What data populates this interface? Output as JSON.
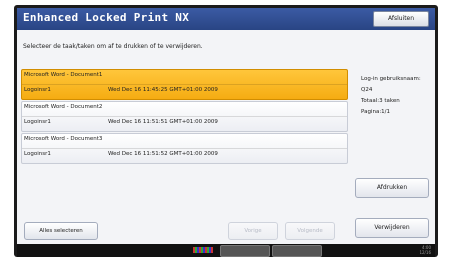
{
  "app": {
    "title": "Enhanced Locked Print NX",
    "close_label": "Afsluiten"
  },
  "instruction": "Selecteer de taak/taken om af te drukken of te verwijderen.",
  "jobs": [
    {
      "document": "Microsoft Word - Document1",
      "user": "Logoinsr1",
      "datetime": "Wed Dec 16 11:45:25 GMT+01:00 2009",
      "selected": true
    },
    {
      "document": "Microsoft Word - Document2",
      "user": "Logoinsr1",
      "datetime": "Wed Dec 16 11:51:51 GMT+01:00 2009",
      "selected": false
    },
    {
      "document": "Microsoft Word - Document3",
      "user": "Logoinsr1",
      "datetime": "Wed Dec 16 11:51:52 GMT+01:00 2009",
      "selected": false
    }
  ],
  "info": {
    "line1": "Log-in gebruiksnaam:",
    "line2": "Q24",
    "line3": "Totaal:3 taken",
    "line4": "Pagina:1/1"
  },
  "buttons": {
    "print": "Afdrukken",
    "delete": "Verwijderen",
    "select_all": "Alles selecteren",
    "prev": "Vorige",
    "next": "Volgende"
  },
  "taskbar": {
    "time": "4:00",
    "date": "12/16"
  }
}
